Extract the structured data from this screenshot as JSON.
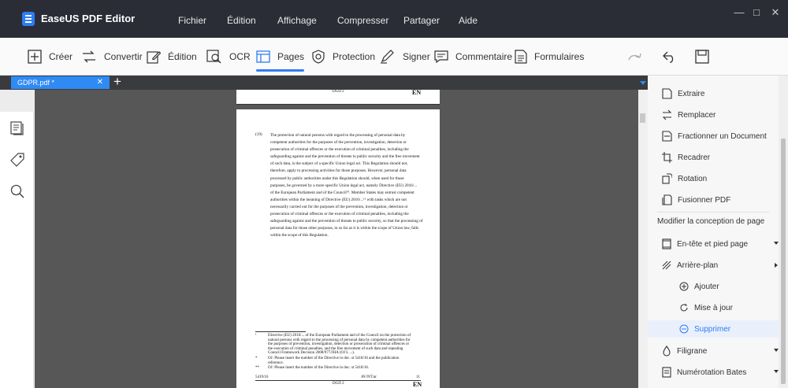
{
  "app": {
    "name": "EaseUS PDF Editor",
    "menu": [
      "Fichier",
      "Édition",
      "Affichage",
      "Compresser",
      "Partager",
      "Aide"
    ]
  },
  "toolbar": {
    "creer": "Créer",
    "convertir": "Convertir",
    "edition": "Édition",
    "ocr": "OCR",
    "pages": "Pages",
    "protection": "Protection",
    "signer": "Signer",
    "commentaire": "Commentaire",
    "formulaires": "Formulaires",
    "active": "Pages"
  },
  "tab": {
    "filename": "GDPR.pdf *"
  },
  "document": {
    "page1": {
      "code": "DGD 2",
      "lang": "EN"
    },
    "page2": {
      "para_number": "(19)",
      "para_lines": [
        "The protection of natural persons with regard to the processing of personal data by",
        "competent authorities for the purposes of the prevention, investigation, detection or",
        "prosecution of criminal offences or the execution of criminal penalties, including the",
        "safeguarding against and the prevention of threats to public security and the free movement",
        "of such data, is the subject of a specific Union legal act. This Regulation should not,",
        "therefore, apply to processing activities for those purposes. However, personal data",
        "processed by public authorities under this Regulation should, when used for those",
        "purposes, be governed by a more specific Union legal act, namely Directive (EU) 2016/...",
        "of the European Parliament and of the Council¹⁰. Member States may entrust competent",
        "authorities within the meaning of Directive (EU) 2016/...¹¹ with tasks which are not",
        "necessarily carried out for the purposes of the prevention, investigation, detection or",
        "prosecution of criminal offences or the execution of criminal penalties, including the",
        "safeguarding against and the prevention of threats to public security, so that the processing of",
        "personal data for those other purposes, in so far as it is within the scope of Union law, falls",
        "within the scope of this Regulation."
      ],
      "fn1_marker": "¹",
      "fn1_lines": [
        "Directive (EU) 2016/... of the European Parliament and of the Council on the protection of",
        "natural persons with regard to the processing of personal data by competent authorities for",
        "the purposes of prevention, investigation, detection or prosecution of criminal offences or",
        "the execution of criminal penalties, and the free movement of such data and repealing",
        "Council Framework Decision 2008/977/JHA (OJ L ...)."
      ],
      "fn2_marker": "*",
      "fn2_lines": [
        "OJ: Please insert the number of the Directive in doc. st 5418/16 and the publication",
        "reference."
      ],
      "fn3_marker": "**",
      "fn3_text": "OJ: Please insert the number of the Directive in doc. st 5418/16.",
      "footer_left": "5419/16",
      "footer_mid": "AV/NT/ar",
      "footer_right": "11",
      "footer_code": "DGD 2",
      "footer_lang": "EN"
    }
  },
  "right_panel": {
    "items_top": [
      "Extraire",
      "Remplacer",
      "Fractionner un Document",
      "Recadrer",
      "Rotation",
      "Fusionner PDF"
    ],
    "section_title": "Modifier la conception de page",
    "header_footer": "En-tête et pied page",
    "background": "Arrière-plan",
    "bg_add": "Ajouter",
    "bg_update": "Mise à jour",
    "bg_delete": "Supprimer",
    "watermark": "Filigrane",
    "bates": "Numérotation Bates"
  },
  "colors": {
    "accent": "#2e7df5",
    "titlebar": "#2b2d36",
    "canvas": "#575757"
  }
}
